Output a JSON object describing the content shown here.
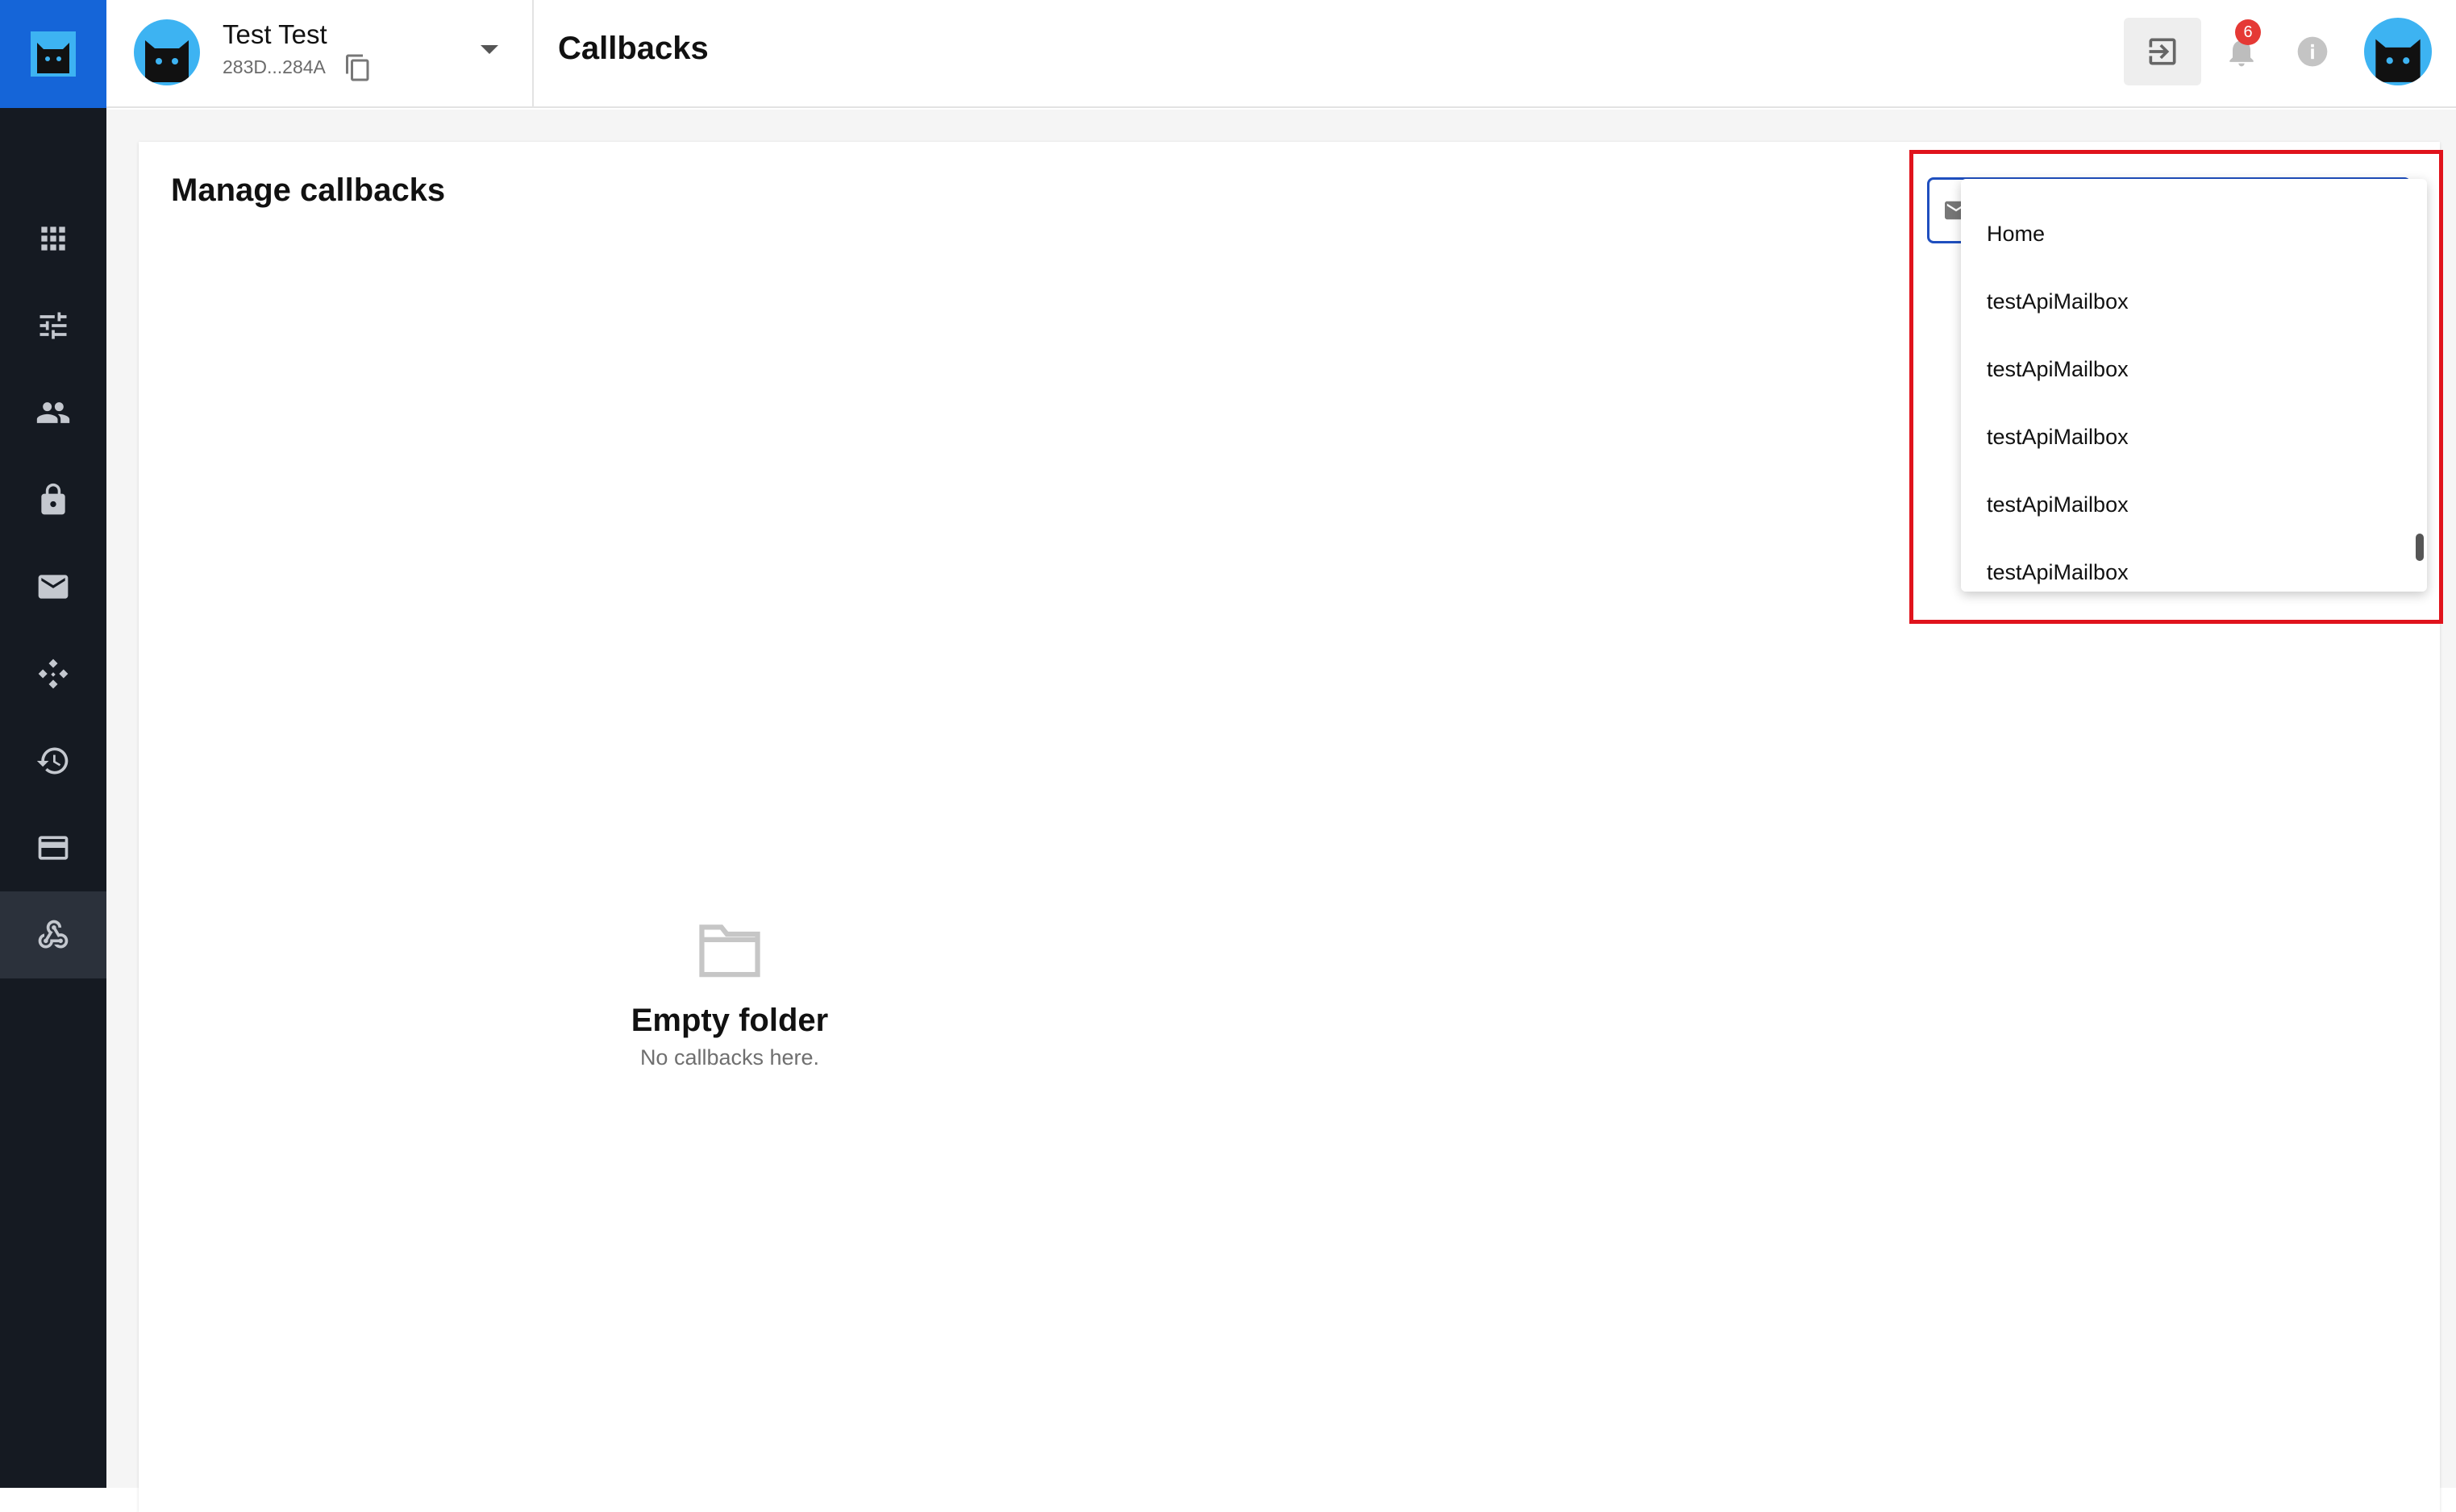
{
  "header": {
    "account_name": "Test Test",
    "account_id": "283D...284A",
    "page_title": "Callbacks",
    "notification_count": "6"
  },
  "sidebar": {
    "icons": [
      "apps-icon",
      "tune-icon",
      "people-icon",
      "lock-icon",
      "mail-icon",
      "diamond-network-icon",
      "history-icon",
      "credit-card-icon",
      "webhook-icon"
    ],
    "active_index": 8
  },
  "main": {
    "card_title": "Manage callbacks",
    "empty_title": "Empty folder",
    "empty_subtitle": "No callbacks here."
  },
  "dropdown": {
    "options": [
      "Home",
      "testApiMailbox",
      "testApiMailbox",
      "testApiMailbox",
      "testApiMailbox",
      "testApiMailbox"
    ]
  },
  "colors": {
    "rail": "#151a22",
    "brand": "#1565d8",
    "highlight": "#e0131c",
    "select_border": "#1f4fbf",
    "badge": "#e53935"
  }
}
